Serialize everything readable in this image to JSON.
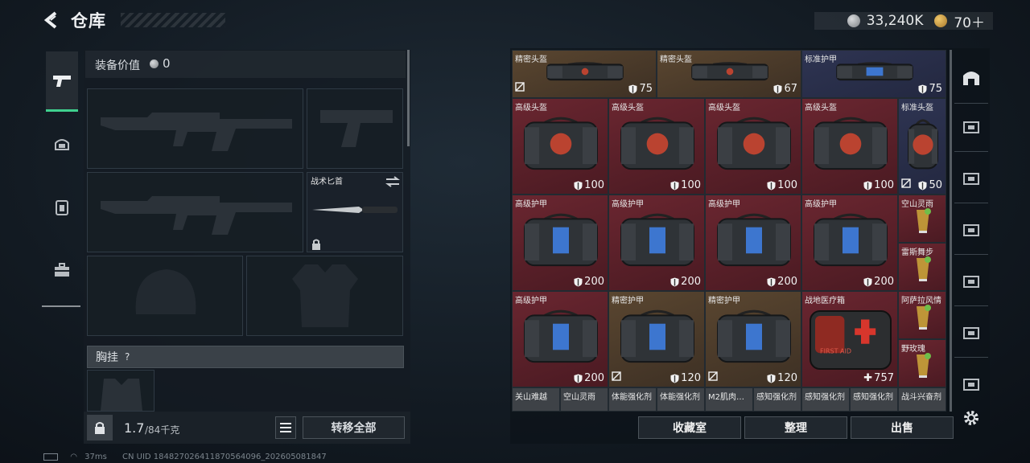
{
  "header": {
    "title": "仓库"
  },
  "currency": {
    "silver": "33,240K",
    "gold": "70＋"
  },
  "equipment": {
    "value_label": "装备价值",
    "value": "0",
    "knife_name": "战术匕首",
    "chest_label": "胸挂",
    "chest_help": "?"
  },
  "weight": {
    "current": "1.7",
    "max": "/84千克"
  },
  "buttons": {
    "transfer_all": "转移全部",
    "collection": "收藏室",
    "sort": "整理",
    "sell": "出售"
  },
  "inventory": {
    "row0": [
      {
        "name": "精密头盔",
        "value": "75",
        "rarity": "gold",
        "icon": "helmet-bag-icon"
      },
      {
        "name": "精密头盔",
        "value": "67",
        "rarity": "gold",
        "icon": "helmet-bag-icon"
      },
      {
        "name": "标准护甲",
        "value": "75",
        "rarity": "blue",
        "icon": "armor-bag-icon"
      }
    ],
    "row1": [
      {
        "name": "高级头盔",
        "value": "100",
        "rarity": "red",
        "icon": "helmet-bag-icon"
      },
      {
        "name": "高级头盔",
        "value": "100",
        "rarity": "red",
        "icon": "helmet-bag-icon"
      },
      {
        "name": "高级头盔",
        "value": "100",
        "rarity": "red",
        "icon": "helmet-bag-icon"
      },
      {
        "name": "高级头盔",
        "value": "100",
        "rarity": "red",
        "icon": "helmet-bag-icon"
      },
      {
        "name": "标准头盔",
        "value": "50",
        "rarity": "blue",
        "icon": "helmet-bag-icon"
      }
    ],
    "row2": [
      {
        "name": "高级护甲",
        "value": "200",
        "rarity": "red",
        "icon": "armor-bag-icon"
      },
      {
        "name": "高级护甲",
        "value": "200",
        "rarity": "red",
        "icon": "armor-bag-icon"
      },
      {
        "name": "高级护甲",
        "value": "200",
        "rarity": "red",
        "icon": "armor-bag-icon"
      },
      {
        "name": "高级护甲",
        "value": "200",
        "rarity": "red",
        "icon": "armor-bag-icon"
      }
    ],
    "drinks": [
      {
        "name": "空山灵雨",
        "rarity": "red"
      },
      {
        "name": "雷斯舞步",
        "rarity": "red"
      },
      {
        "name": "阿萨拉风情",
        "rarity": "red"
      },
      {
        "name": "野玫瑰",
        "rarity": "red"
      }
    ],
    "row3": [
      {
        "name": "高级护甲",
        "value": "200",
        "rarity": "red",
        "icon": "armor-bag-icon"
      },
      {
        "name": "精密护甲",
        "value": "120",
        "rarity": "gold",
        "icon": "armor-bag-icon"
      },
      {
        "name": "精密护甲",
        "value": "120",
        "rarity": "gold",
        "icon": "armor-bag-icon"
      },
      {
        "name": "战地医疗箱",
        "value": "757",
        "rarity": "red",
        "icon": "first-aid-kit-icon"
      }
    ],
    "row4": [
      "关山难越",
      "空山灵雨",
      "体能强化剂",
      "体能强化剂",
      "M2肌肉…",
      "感知强化剂",
      "感知强化剂",
      "感知强化剂",
      "战斗兴奋剂"
    ]
  },
  "first_aid_label": "FIRST AID",
  "right_sidebar": [
    "container-icon",
    "storage-iv-icon",
    "storage-iv-add-icon",
    "storage-v-icon",
    "storage-iii-icon",
    "storage-iii-icon",
    "storage-iii-icon",
    "storage-iii-icon"
  ],
  "status": {
    "ping": "37ms",
    "uid": "CN UID 18482702641187056409​6_202605081847"
  },
  "colors": {
    "red": "#6a2630",
    "gold": "#5a4630",
    "blue": "#2e3452",
    "accent": "#3fd08f"
  }
}
